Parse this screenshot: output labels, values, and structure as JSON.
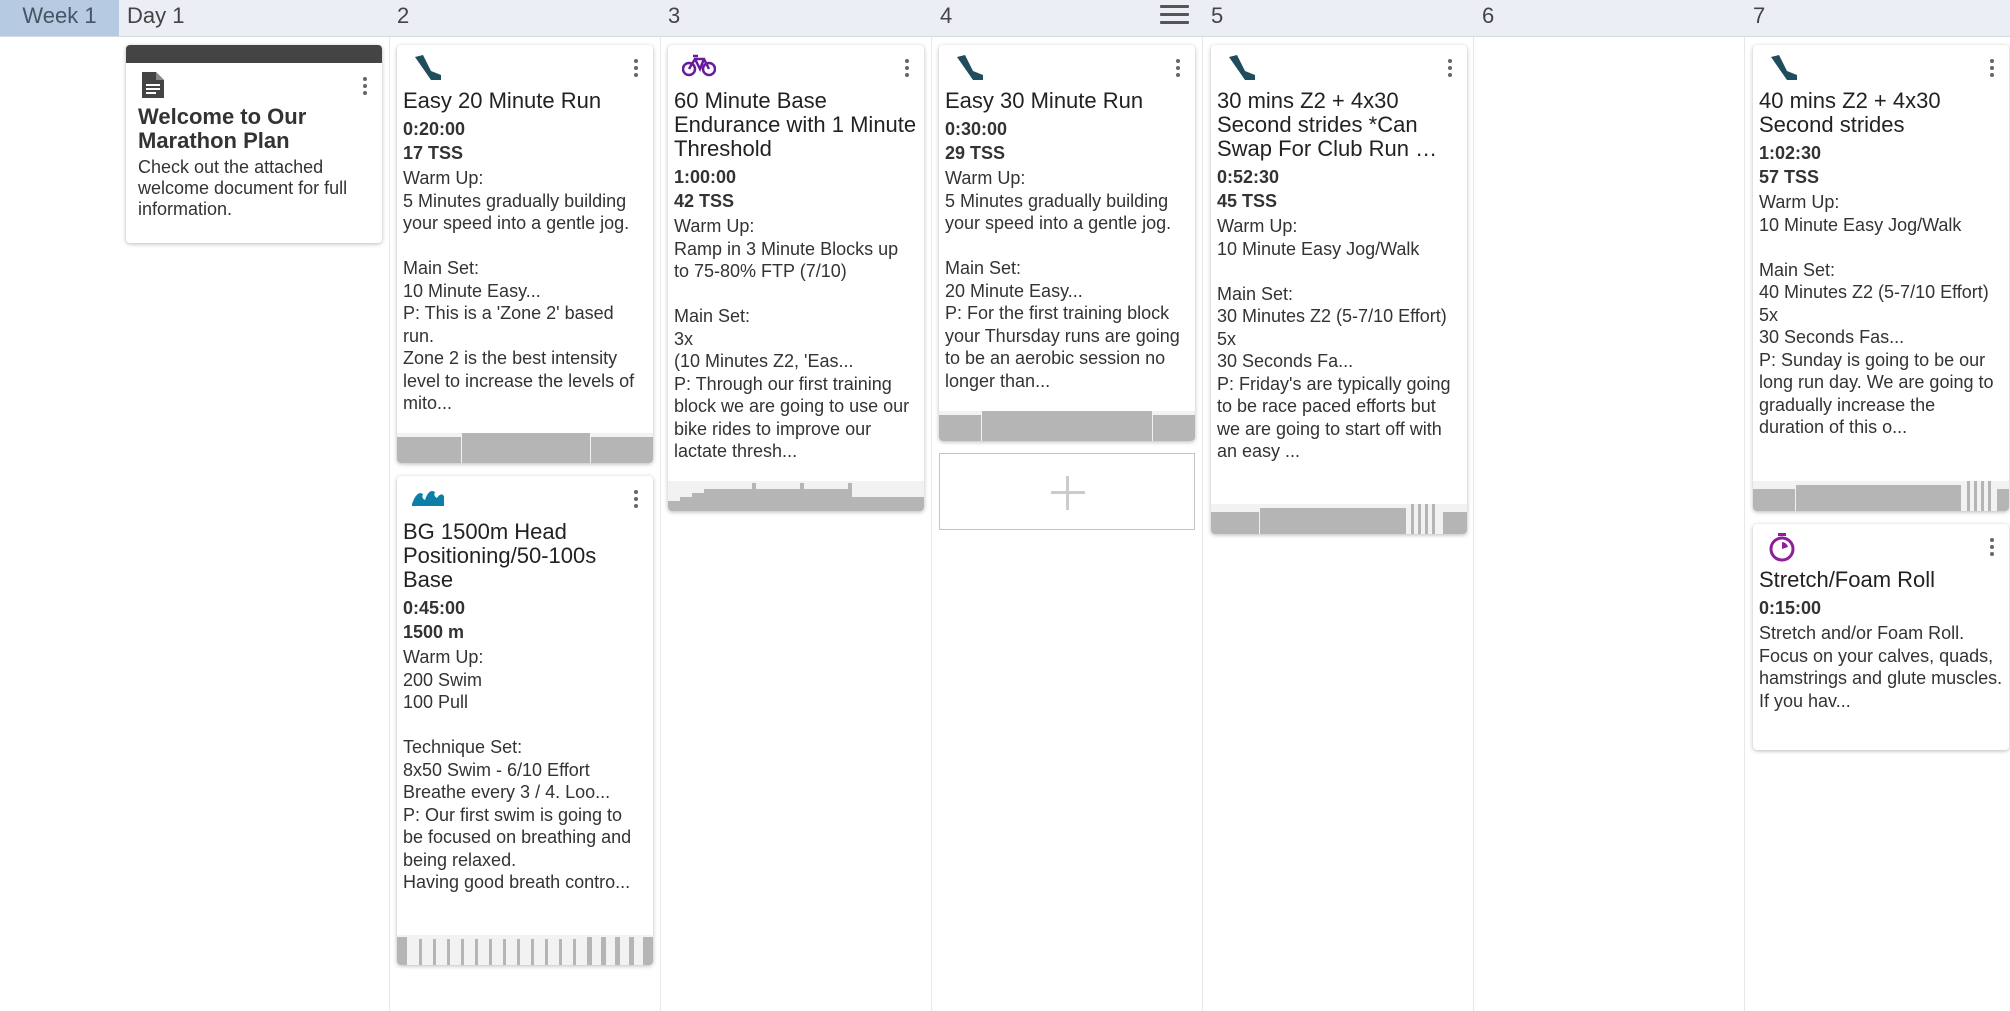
{
  "header": {
    "week_label": "Week 1",
    "days": [
      "Day 1",
      "2",
      "3",
      "4",
      "5",
      "6",
      "7"
    ]
  },
  "colors": {
    "run_icon": "#1f4d5e",
    "bike_icon": "#6a1b9a",
    "swim_icon": "#0b7fa8",
    "other_icon": "#8e1f9a",
    "note_bar": "#444444",
    "profile_fill": "#b5b5b5",
    "week_highlight": "#b6cbe2",
    "header_bg": "#ebeff5"
  },
  "cards": {
    "welcome": {
      "icon": "document-icon",
      "title": "Welcome to Our Marathon Plan",
      "description": "Check out the attached welcome document for full information."
    },
    "run20": {
      "icon": "running-shoe-icon",
      "title": "Easy 20 Minute Run",
      "duration": "0:20:00",
      "metric": "17 TSS",
      "description": "Warm Up:\n5 Minutes gradually building your speed into a gentle jog.\n\nMain Set:\n10 Minute Easy...\nP: This is a 'Zone 2' based run.\nZone 2 is the best intensity level to increase the levels of mito..."
    },
    "swim": {
      "icon": "swim-wave-icon",
      "title": "BG 1500m Head Positioning/50-100s Base",
      "duration": "0:45:00",
      "metric": "1500 m",
      "description": "Warm Up:\n200 Swim\n100 Pull\n\nTechnique Set:\n8x50 Swim - 6/10 Effort\nBreathe every 3 / 4. Loo...\nP: Our first swim is going to be focused on breathing and being relaxed.\nHaving good breath contro..."
    },
    "bike": {
      "icon": "bicycle-icon",
      "title": "60 Minute Base Endurance with 1 Minute Threshold",
      "duration": "1:00:00",
      "metric": "42 TSS",
      "description": "Warm Up:\nRamp in 3 Minute Blocks up to 75-80% FTP (7/10)\n\nMain Set:\n3x\n(10 Minutes Z2, 'Eas...\nP: Through our first training block we are going to use our bike rides to improve our lactate thresh..."
    },
    "run30": {
      "icon": "running-shoe-icon",
      "title": "Easy 30 Minute Run",
      "duration": "0:30:00",
      "metric": "29 TSS",
      "description": "Warm Up:\n5 Minutes gradually building your speed into a gentle jog.\n\nMain Set:\n20 Minute Easy...\nP: For the first training block your Thursday runs are going to be an aerobic session no longer than..."
    },
    "strides30": {
      "icon": "running-shoe-icon",
      "title": "30 mins Z2 + 4x30 Second strides *Can Swap For Club Run …",
      "duration": "0:52:30",
      "metric": "45 TSS",
      "description": "Warm Up:\n10 Minute Easy Jog/Walk\n\nMain Set:\n30 Minutes Z2 (5-7/10 Effort)\n5x\n30 Seconds Fa...\nP: Friday's are typically going to be race paced efforts but we are going to start off with an easy ..."
    },
    "strides40": {
      "icon": "running-shoe-icon",
      "title": "40 mins Z2 + 4x30 Second strides",
      "duration": "1:02:30",
      "metric": "57 TSS",
      "description": "Warm Up:\n10 Minute Easy Jog/Walk\n\nMain Set:\n40 Minutes Z2 (5-7/10 Effort)\n5x\n30 Seconds Fas...\nP: Sunday is going to be our long run day. We are going to gradually increase the duration of this o..."
    },
    "stretch": {
      "icon": "stopwatch-icon",
      "title": "Stretch/Foam Roll",
      "duration": "0:15:00",
      "description": "Stretch and/or Foam Roll.\nFocus on your calves, quads, hamstrings and glute muscles.\nIf you hav..."
    }
  }
}
